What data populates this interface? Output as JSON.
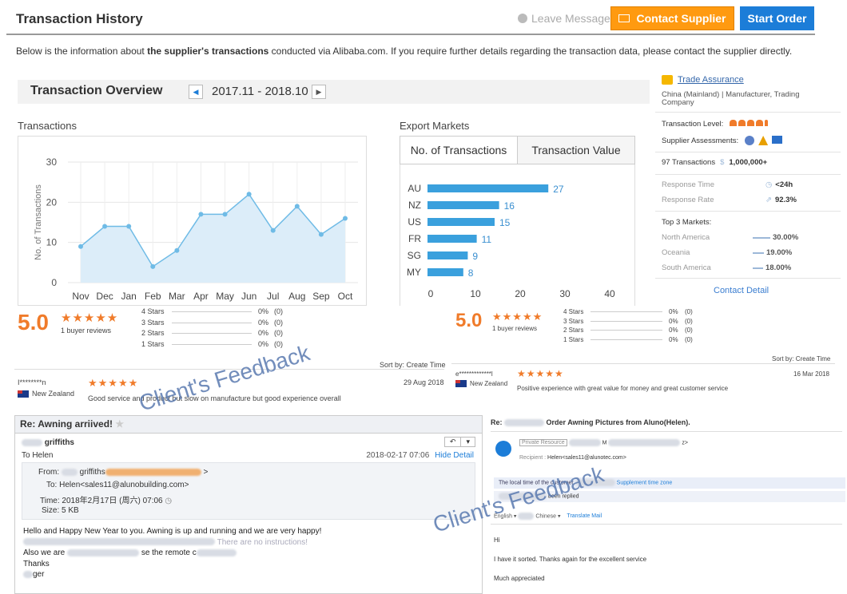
{
  "header": {
    "title": "Transaction History",
    "leave_messages": "Leave Messages",
    "contact_supplier": "Contact Supplier",
    "start_order": "Start Order"
  },
  "intro": {
    "pre": "Below is the information about ",
    "bold": "the supplier's transactions",
    "post": " conducted via Alibaba.com. If you require further details regarding the transaction data, please contact the supplier directly."
  },
  "overview": {
    "title": "Transaction Overview",
    "period": "2017.11 - 2018.10"
  },
  "transactions_label": "Transactions",
  "export_label": "Export Markets",
  "export_tabs": [
    "No. of Transactions",
    "Transaction Value"
  ],
  "chart_data": [
    {
      "type": "area",
      "ylabel": "No. of Transactions",
      "categories": [
        "Nov",
        "Dec",
        "Jan",
        "Feb",
        "Mar",
        "Apr",
        "May",
        "Jun",
        "Jul",
        "Aug",
        "Sep",
        "Oct"
      ],
      "values": [
        9,
        14,
        14,
        4,
        8,
        17,
        17,
        22,
        13,
        19,
        12,
        16
      ],
      "yticks": [
        0,
        10,
        20,
        30
      ],
      "ylim": [
        0,
        30
      ],
      "color": "#6fbbe6"
    },
    {
      "type": "bar",
      "orientation": "horizontal",
      "categories": [
        "AU",
        "NZ",
        "US",
        "FR",
        "SG",
        "MY"
      ],
      "values": [
        27,
        16,
        15,
        11,
        9,
        8
      ],
      "xticks": [
        0,
        10,
        20,
        30,
        40
      ],
      "xlim": [
        0,
        40
      ],
      "color": "#3aa0dd"
    }
  ],
  "supplier": {
    "trade_assurance": "Trade Assurance",
    "location": "China (Mainland)  |  Manufacturer, Trading Company",
    "transaction_level": "Transaction Level:",
    "assessments": "Supplier Assessments:",
    "transactions_count": "97 Transactions",
    "transactions_value": "1,000,000+",
    "response_time_label": "Response Time",
    "response_time": "<24h",
    "response_rate_label": "Response Rate",
    "response_rate": "92.3%",
    "top_markets_label": "Top 3 Markets:",
    "markets": [
      {
        "name": "North America",
        "pct": "30.00%"
      },
      {
        "name": "Oceania",
        "pct": "19.00%"
      },
      {
        "name": "South America",
        "pct": "18.00%"
      }
    ],
    "contact_detail": "Contact Detail"
  },
  "reviews": [
    {
      "score": "5.0",
      "count": "1 buyer reviews",
      "levels": [
        {
          "label": "4 Stars",
          "pct": "0%",
          "n": "(0)"
        },
        {
          "label": "3 Stars",
          "pct": "0%",
          "n": "(0)"
        },
        {
          "label": "2 Stars",
          "pct": "0%",
          "n": "(0)"
        },
        {
          "label": "1 Stars",
          "pct": "0%",
          "n": "(0)"
        }
      ],
      "sort": "Sort by: Create Time",
      "reviewer": "I********n",
      "country": "New Zealand",
      "date": "29 Aug 2018",
      "comment": "Good service and product but slow on manufacture but good experience overall"
    },
    {
      "score": "5.0",
      "count": "1 buyer reviews",
      "levels": [
        {
          "label": "4 Stars",
          "pct": "0%",
          "n": "(0)"
        },
        {
          "label": "3 Stars",
          "pct": "0%",
          "n": "(0)"
        },
        {
          "label": "2 Stars",
          "pct": "0%",
          "n": "(0)"
        },
        {
          "label": "1 Stars",
          "pct": "0%",
          "n": "(0)"
        }
      ],
      "sort": "Sort by: Create Time",
      "reviewer": "e*************l",
      "country": "New Zealand",
      "date": "16 Mar 2018",
      "comment": "Positive experience with great value for money and great customer service"
    }
  ],
  "stars_glyph": "★★★★★",
  "watermark": "Client's Feedback",
  "email_left": {
    "subject": "Re: Awning arriived!",
    "sender": "griffiths",
    "to_line": "To Helen",
    "datetime": "2018-02-17 07:06",
    "hide_detail": "Hide Detail",
    "from_label": "From:",
    "from_name": "griffiths",
    "to_label": "To:",
    "to_value": "Helen<sales11@alunobuilding.com>",
    "time_label": "Time:",
    "time_value": "2018年2月17日 (周六) 07:06",
    "size_label": "Size:",
    "size_value": "5 KB",
    "body1": "Hello and Happy New Year to you. Awning is up and running and we are very happy!",
    "body2": "There are no instructions!",
    "body3_a": "Also we are",
    "body3_b": "se the remote c",
    "body4": "Thanks",
    "body5": "ger"
  },
  "email_right": {
    "subject_a": "Re:",
    "subject_b": "Order Awning Pictures from Aluno(Helen).",
    "private_badge": "Private Resource",
    "recipient_label": "Recipient :",
    "recipient": "Helen<sales11@alunotec.com>",
    "local_time": "The local time of the customer",
    "supplement": "Supplement time zone",
    "replied": "been replied",
    "lang_from": "English",
    "lang_to": "Chinese",
    "translate": "Translate Mail",
    "line1": "Hi",
    "line2": "I have it sorted. Thanks again for the excellent service",
    "line3": "Much appreciated"
  }
}
